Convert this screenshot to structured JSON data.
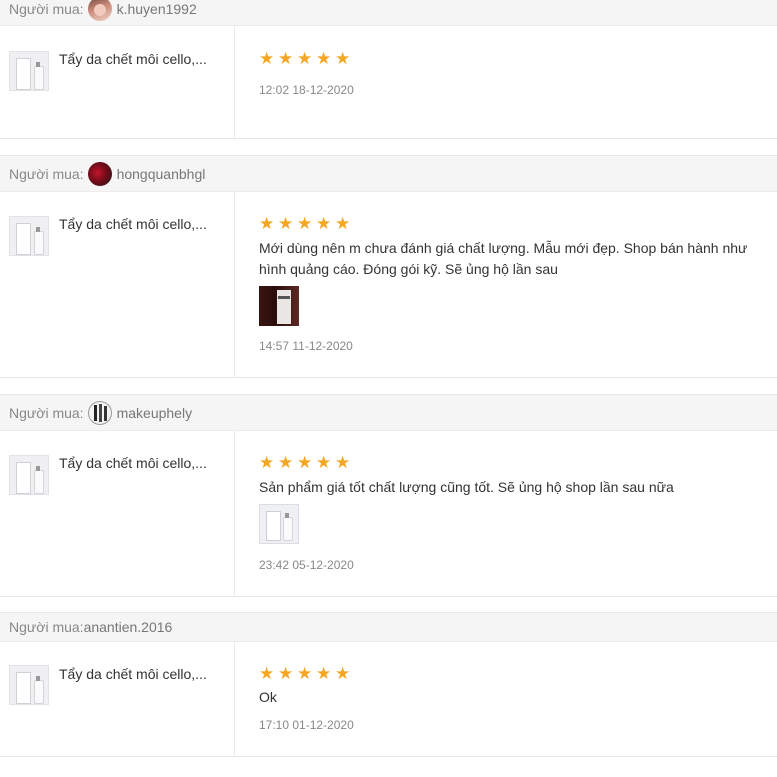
{
  "reviews": [
    {
      "buyer_label": "Người mua:",
      "buyer_name": "k.huyen1992",
      "avatar": "avatar-photo",
      "product_name": "Tẩy da chết môi cello,...",
      "rating": 5,
      "comment": "",
      "has_photo": false,
      "timestamp": "12:02 18-12-2020"
    },
    {
      "buyer_label": "Người mua:",
      "buyer_name": "hongquanbhgl",
      "avatar": "avatar-photo",
      "product_name": "Tẩy da chết môi cello,...",
      "rating": 5,
      "comment": "Mới dùng nên m chưa đánh giá chất lượng. Mẫu mới đẹp. Shop bán hành như hình quảng cáo. Đóng gói kỹ. Sẽ ủng hộ lần sau",
      "has_photo": true,
      "timestamp": "14:57 11-12-2020"
    },
    {
      "buyer_label": "Người mua:",
      "buyer_name": "makeuphely",
      "avatar": "avatar-photo",
      "product_name": "Tẩy da chết môi cello,...",
      "rating": 5,
      "comment": "Sản phẩm giá tốt chất lượng cũng tốt. Sẽ ủng hộ shop lần sau nữa",
      "has_photo": true,
      "timestamp": "23:42 05-12-2020"
    },
    {
      "buyer_label": "Người mua:",
      "buyer_name": "anantien.2016",
      "avatar": "",
      "product_name": "Tẩy da chết môi cello,...",
      "rating": 5,
      "comment": "Ok",
      "has_photo": false,
      "timestamp": "17:10 01-12-2020"
    }
  ],
  "icons": {
    "star": "star-icon"
  },
  "colors": {
    "star": "#f5a623",
    "bar_bg": "#f5f5f5"
  }
}
